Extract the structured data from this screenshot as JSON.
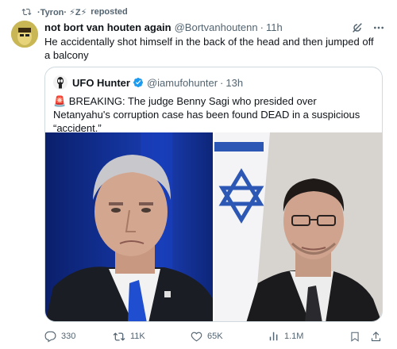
{
  "repost": {
    "user": "·Tyron· ⚡Z⚡",
    "label": "reposted"
  },
  "tweet": {
    "author_name": "not bort van houten again",
    "handle": "@Bortvanhoutenn",
    "time": "11h",
    "text": "He accidentally shot himself in the back of the head and then jumped off a balcony"
  },
  "quote": {
    "author_name": "UFO Hunter",
    "handle": "@iamufohunter",
    "time": "13h",
    "text": "🚨 BREAKING: The judge Benny Sagi who presided over Netanyahu's corruption case has been found DEAD in a suspicious “accident.”"
  },
  "actions": {
    "replies": "330",
    "reposts": "11K",
    "likes": "65K",
    "views": "1.1M"
  },
  "colors": {
    "text": "#0f1419",
    "secondary": "#536471",
    "border": "#cfd9de",
    "verified": "#1d9bf0"
  },
  "icons": [
    "repost-icon",
    "grok-icon",
    "more-icon",
    "verified-badge-icon",
    "reply-icon",
    "retweet-icon",
    "like-icon",
    "views-icon",
    "bookmark-icon",
    "share-icon"
  ]
}
